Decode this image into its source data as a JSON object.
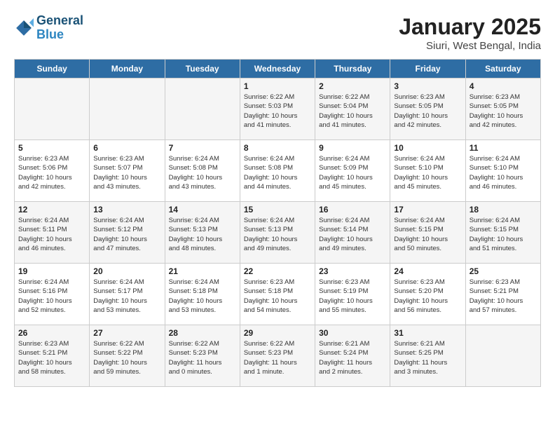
{
  "logo": {
    "line1": "General",
    "line2": "Blue"
  },
  "title": "January 2025",
  "location": "Siuri, West Bengal, India",
  "weekdays": [
    "Sunday",
    "Monday",
    "Tuesday",
    "Wednesday",
    "Thursday",
    "Friday",
    "Saturday"
  ],
  "weeks": [
    [
      {
        "day": "",
        "info": ""
      },
      {
        "day": "",
        "info": ""
      },
      {
        "day": "",
        "info": ""
      },
      {
        "day": "1",
        "info": "Sunrise: 6:22 AM\nSunset: 5:03 PM\nDaylight: 10 hours\nand 41 minutes."
      },
      {
        "day": "2",
        "info": "Sunrise: 6:22 AM\nSunset: 5:04 PM\nDaylight: 10 hours\nand 41 minutes."
      },
      {
        "day": "3",
        "info": "Sunrise: 6:23 AM\nSunset: 5:05 PM\nDaylight: 10 hours\nand 42 minutes."
      },
      {
        "day": "4",
        "info": "Sunrise: 6:23 AM\nSunset: 5:05 PM\nDaylight: 10 hours\nand 42 minutes."
      }
    ],
    [
      {
        "day": "5",
        "info": "Sunrise: 6:23 AM\nSunset: 5:06 PM\nDaylight: 10 hours\nand 42 minutes."
      },
      {
        "day": "6",
        "info": "Sunrise: 6:23 AM\nSunset: 5:07 PM\nDaylight: 10 hours\nand 43 minutes."
      },
      {
        "day": "7",
        "info": "Sunrise: 6:24 AM\nSunset: 5:08 PM\nDaylight: 10 hours\nand 43 minutes."
      },
      {
        "day": "8",
        "info": "Sunrise: 6:24 AM\nSunset: 5:08 PM\nDaylight: 10 hours\nand 44 minutes."
      },
      {
        "day": "9",
        "info": "Sunrise: 6:24 AM\nSunset: 5:09 PM\nDaylight: 10 hours\nand 45 minutes."
      },
      {
        "day": "10",
        "info": "Sunrise: 6:24 AM\nSunset: 5:10 PM\nDaylight: 10 hours\nand 45 minutes."
      },
      {
        "day": "11",
        "info": "Sunrise: 6:24 AM\nSunset: 5:10 PM\nDaylight: 10 hours\nand 46 minutes."
      }
    ],
    [
      {
        "day": "12",
        "info": "Sunrise: 6:24 AM\nSunset: 5:11 PM\nDaylight: 10 hours\nand 46 minutes."
      },
      {
        "day": "13",
        "info": "Sunrise: 6:24 AM\nSunset: 5:12 PM\nDaylight: 10 hours\nand 47 minutes."
      },
      {
        "day": "14",
        "info": "Sunrise: 6:24 AM\nSunset: 5:13 PM\nDaylight: 10 hours\nand 48 minutes."
      },
      {
        "day": "15",
        "info": "Sunrise: 6:24 AM\nSunset: 5:13 PM\nDaylight: 10 hours\nand 49 minutes."
      },
      {
        "day": "16",
        "info": "Sunrise: 6:24 AM\nSunset: 5:14 PM\nDaylight: 10 hours\nand 49 minutes."
      },
      {
        "day": "17",
        "info": "Sunrise: 6:24 AM\nSunset: 5:15 PM\nDaylight: 10 hours\nand 50 minutes."
      },
      {
        "day": "18",
        "info": "Sunrise: 6:24 AM\nSunset: 5:15 PM\nDaylight: 10 hours\nand 51 minutes."
      }
    ],
    [
      {
        "day": "19",
        "info": "Sunrise: 6:24 AM\nSunset: 5:16 PM\nDaylight: 10 hours\nand 52 minutes."
      },
      {
        "day": "20",
        "info": "Sunrise: 6:24 AM\nSunset: 5:17 PM\nDaylight: 10 hours\nand 53 minutes."
      },
      {
        "day": "21",
        "info": "Sunrise: 6:24 AM\nSunset: 5:18 PM\nDaylight: 10 hours\nand 53 minutes."
      },
      {
        "day": "22",
        "info": "Sunrise: 6:23 AM\nSunset: 5:18 PM\nDaylight: 10 hours\nand 54 minutes."
      },
      {
        "day": "23",
        "info": "Sunrise: 6:23 AM\nSunset: 5:19 PM\nDaylight: 10 hours\nand 55 minutes."
      },
      {
        "day": "24",
        "info": "Sunrise: 6:23 AM\nSunset: 5:20 PM\nDaylight: 10 hours\nand 56 minutes."
      },
      {
        "day": "25",
        "info": "Sunrise: 6:23 AM\nSunset: 5:21 PM\nDaylight: 10 hours\nand 57 minutes."
      }
    ],
    [
      {
        "day": "26",
        "info": "Sunrise: 6:23 AM\nSunset: 5:21 PM\nDaylight: 10 hours\nand 58 minutes."
      },
      {
        "day": "27",
        "info": "Sunrise: 6:22 AM\nSunset: 5:22 PM\nDaylight: 10 hours\nand 59 minutes."
      },
      {
        "day": "28",
        "info": "Sunrise: 6:22 AM\nSunset: 5:23 PM\nDaylight: 11 hours\nand 0 minutes."
      },
      {
        "day": "29",
        "info": "Sunrise: 6:22 AM\nSunset: 5:23 PM\nDaylight: 11 hours\nand 1 minute."
      },
      {
        "day": "30",
        "info": "Sunrise: 6:21 AM\nSunset: 5:24 PM\nDaylight: 11 hours\nand 2 minutes."
      },
      {
        "day": "31",
        "info": "Sunrise: 6:21 AM\nSunset: 5:25 PM\nDaylight: 11 hours\nand 3 minutes."
      },
      {
        "day": "",
        "info": ""
      }
    ]
  ]
}
